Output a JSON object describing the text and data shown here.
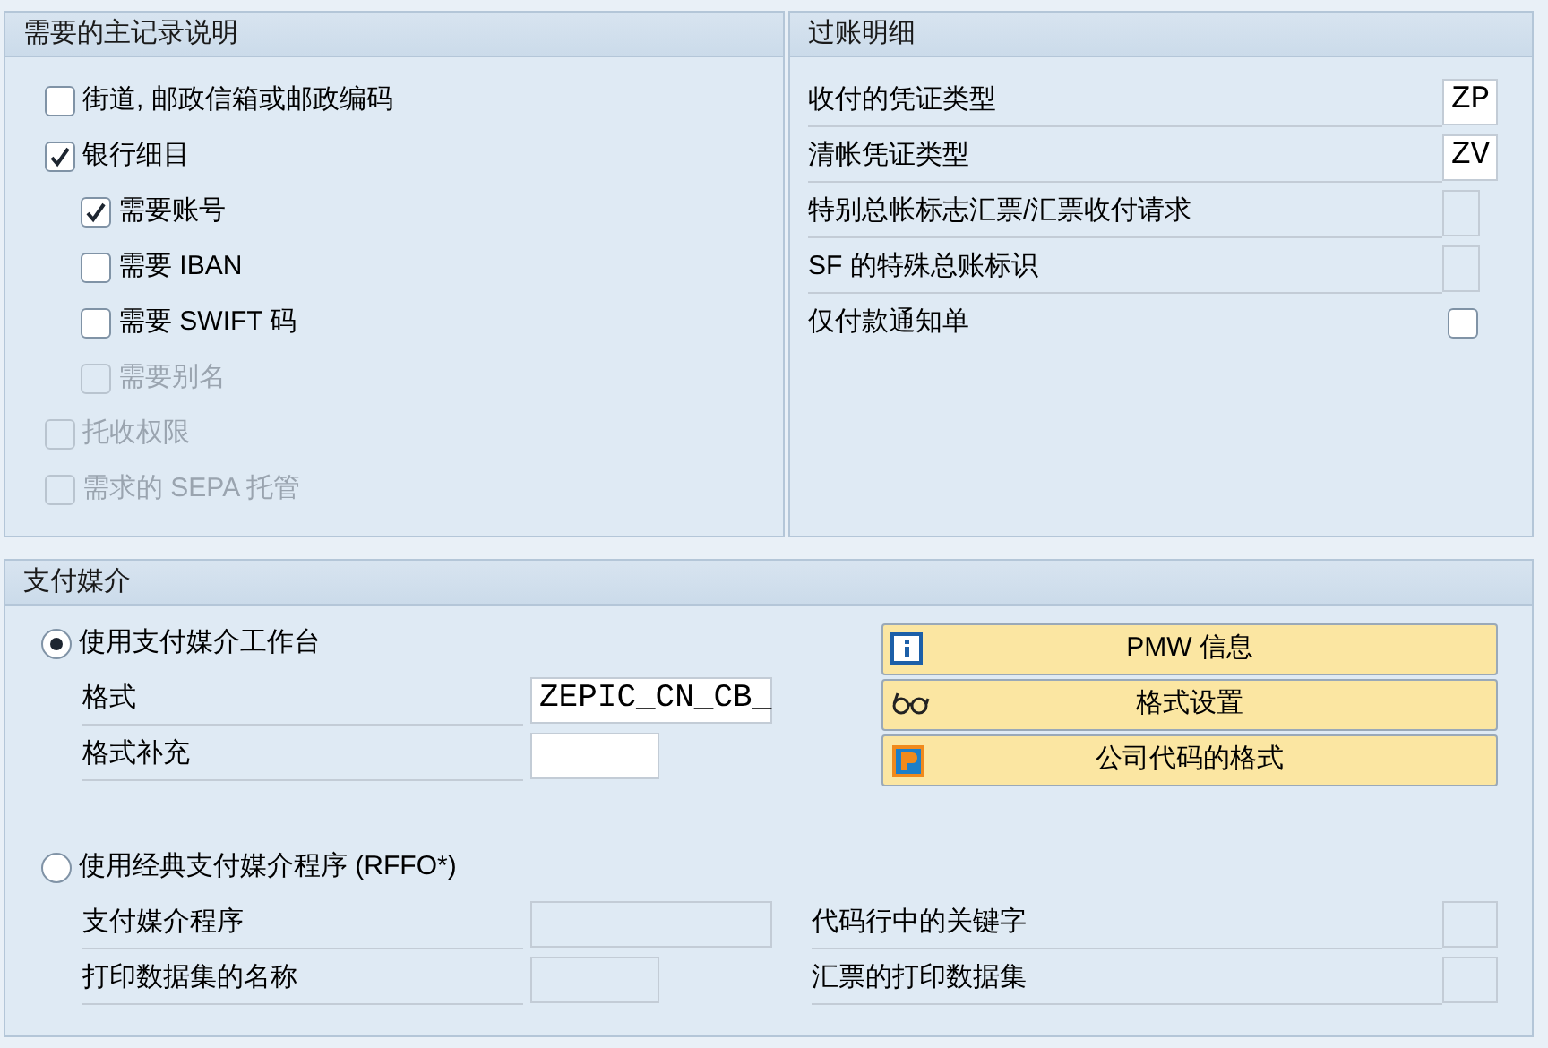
{
  "master_record": {
    "title": "需要的主记录说明",
    "options": [
      {
        "label": "街道, 邮政信箱或邮政编码",
        "checked": false,
        "disabled": false
      },
      {
        "label": "银行细目",
        "checked": true,
        "disabled": false,
        "children": [
          {
            "label": "需要账号",
            "checked": true,
            "disabled": false
          },
          {
            "label": "需要 IBAN",
            "checked": false,
            "disabled": false
          },
          {
            "label": "需要 SWIFT 码",
            "checked": false,
            "disabled": false
          },
          {
            "label": "需要别名",
            "checked": false,
            "disabled": true
          }
        ]
      },
      {
        "label": "托收权限",
        "checked": false,
        "disabled": true
      },
      {
        "label": "需求的 SEPA 托管",
        "checked": false,
        "disabled": true
      }
    ]
  },
  "posting": {
    "title": "过账明细",
    "rows": [
      {
        "kind": "field",
        "label": "收付的凭证类型",
        "value": "ZP",
        "disabled": false
      },
      {
        "kind": "field",
        "label": "清帐凭证类型",
        "value": "ZV",
        "disabled": false
      },
      {
        "kind": "field",
        "label": "特别总帐标志汇票/汇票收付请求",
        "disabled": true
      },
      {
        "kind": "field",
        "label": "SF 的特殊总账标识",
        "disabled": true
      },
      {
        "kind": "checkbox",
        "label": "仅付款通知单",
        "checked": false
      }
    ]
  },
  "payment_medium": {
    "title": "支付媒介",
    "options": [
      {
        "label": "使用支付媒介工作台",
        "selected": true,
        "fields": [
          {
            "label": "格式",
            "value": "ZEPIC_CN_CB_",
            "disabled": false
          },
          {
            "label": "格式补充",
            "disabled": false
          }
        ],
        "buttons": [
          {
            "label": "PMW 信息",
            "kind": "info"
          },
          {
            "label": "格式设置",
            "kind": "glasses"
          },
          {
            "label": "公司代码的格式",
            "kind": "company"
          }
        ]
      },
      {
        "label": "使用经典支付媒介程序 (RFFO*)",
        "selected": false,
        "fields": [
          {
            "label": "支付媒介程序",
            "disabled": true
          },
          {
            "label": "打印数据集的名称",
            "disabled": true
          }
        ],
        "side_fields": [
          {
            "label": "代码行中的关键字",
            "disabled": true
          },
          {
            "label": "汇票的打印数据集",
            "disabled": true
          }
        ]
      }
    ]
  }
}
